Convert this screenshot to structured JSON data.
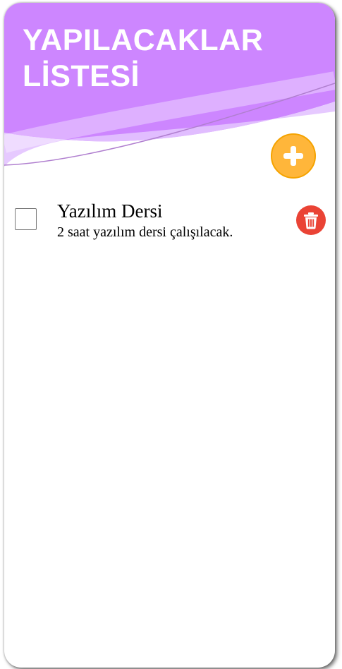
{
  "header": {
    "title": "YAPILACAKLAR LİSTESİ",
    "colors": {
      "primary": "#cd86ff",
      "wave_light": "#e3c3ff",
      "add_button": "#ffb63a",
      "delete_button": "#ea4335"
    }
  },
  "actions": {
    "add_icon": "plus-icon"
  },
  "todos": [
    {
      "title": "Yazılım Dersi",
      "description": "2 saat yazılım dersi çalışılacak.",
      "checked": false,
      "delete_icon": "trash-icon"
    }
  ]
}
